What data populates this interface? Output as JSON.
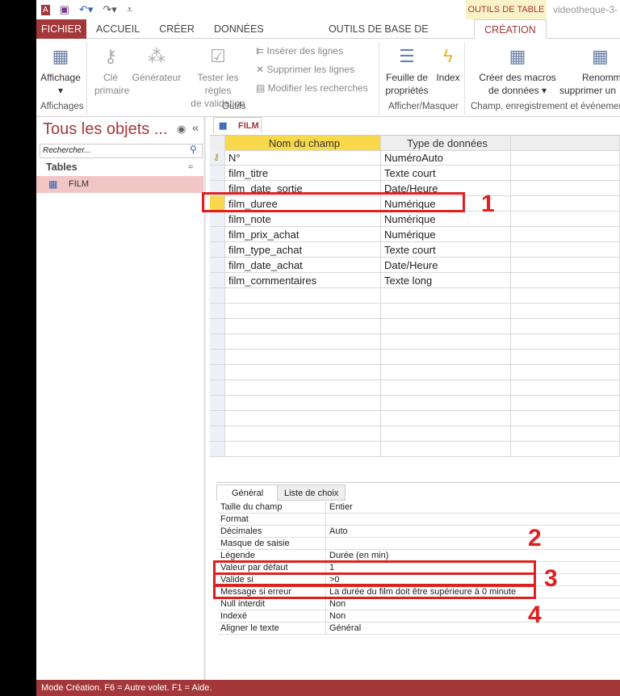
{
  "qat": {
    "icons": [
      "access-logo-icon",
      "save-icon",
      "undo-icon",
      "redo-icon",
      "customize-icon"
    ]
  },
  "context_tab": "OUTILS DE TABLE",
  "doc_title": "videotheque-3-",
  "tabs": [
    "FICHIER",
    "ACCUEIL",
    "CRÉER",
    "DONNÉES EXTERNES",
    "OUTILS DE BASE DE DONNÉES",
    "CRÉATION"
  ],
  "ribbon": {
    "affichage": "Affichage",
    "affichages_group": "Affichages",
    "cle": "Clé",
    "primaire": "primaire",
    "generateur": "Générateur",
    "tester1": "Tester les règles",
    "tester2": "de validation",
    "inserer": "Insérer des lignes",
    "supprimer": "Supprimer les lignes",
    "modifier": "Modifier les recherches",
    "outils_group": "Outils",
    "feuille1": "Feuille de",
    "feuille2": "propriétés",
    "index": "Index",
    "afficher_group": "Afficher/Masquer",
    "macros1": "Créer des macros",
    "macros2": "de données ▾",
    "renommer1": "Renomm",
    "renommer2": "supprimer un",
    "champ_group": "Champ, enregistrement et événemen"
  },
  "nav": {
    "title": "Tous les objets ...",
    "search_placeholder": "Rechercher...",
    "section": "Tables",
    "items": [
      "FILM"
    ]
  },
  "object_tab": "FILM",
  "grid": {
    "headers": [
      "Nom du champ",
      "Type de données"
    ],
    "rows": [
      [
        "N°",
        "NuméroAuto"
      ],
      [
        "film_titre",
        "Texte court"
      ],
      [
        "film_date_sortie",
        "Date/Heure"
      ],
      [
        "film_duree",
        "Numérique"
      ],
      [
        "film_note",
        "Numérique"
      ],
      [
        "film_prix_achat",
        "Numérique"
      ],
      [
        "film_type_achat",
        "Texte court"
      ],
      [
        "film_date_achat",
        "Date/Heure"
      ],
      [
        "film_commentaires",
        "Texte long"
      ]
    ],
    "selected_row": 3
  },
  "props": {
    "tabs": [
      "Général",
      "Liste de choix"
    ],
    "rows": [
      [
        "Taille du champ",
        "Entier"
      ],
      [
        "Format",
        ""
      ],
      [
        "Décimales",
        "Auto"
      ],
      [
        "Masque de saisie",
        ""
      ],
      [
        "Légende",
        "Durée (en min)"
      ],
      [
        "Valeur par défaut",
        "1"
      ],
      [
        "Valide si",
        ">0"
      ],
      [
        "Message si erreur",
        "La durée du film doit être supérieure à 0 minute"
      ],
      [
        "Null interdit",
        "Non"
      ],
      [
        "Indexé",
        "Non"
      ],
      [
        "Aligner le texte",
        "Général"
      ]
    ]
  },
  "annotations": [
    "1",
    "2",
    "3",
    "4"
  ],
  "colors": {
    "accent": "#a4373a",
    "annotation": "#e02020",
    "header_selected": "#f9d84b"
  },
  "status": "Mode Création. F6 = Autre volet. F1 = Aide."
}
